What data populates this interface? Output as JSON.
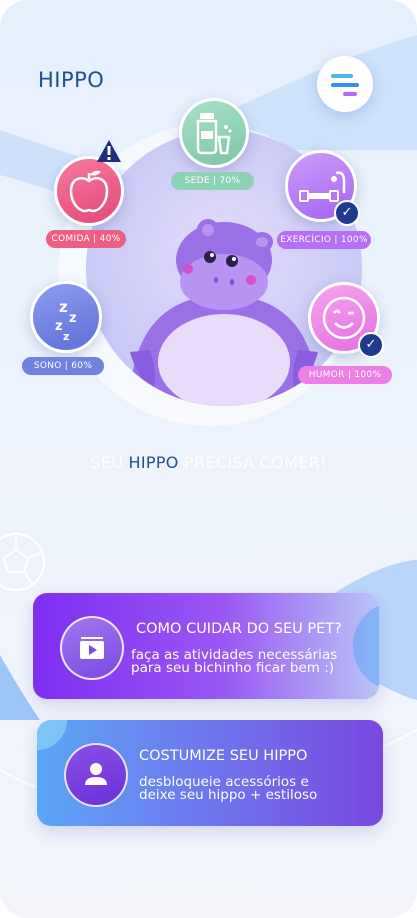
{
  "header": {
    "title": "HIPPO",
    "menu_icon": "menu-lines-icon"
  },
  "stats": [
    {
      "name": "sede",
      "label": "SEDE | 70%",
      "value_percent": 70,
      "icon": "water-bottle-icon",
      "color": "#8ed2b6"
    },
    {
      "name": "comida",
      "label": "COMIDA | 40%",
      "value_percent": 40,
      "icon": "apple-icon",
      "color": "#ee5f85",
      "alert": "warning-icon"
    },
    {
      "name": "exercicio",
      "label": "EXERCÍCIO | 100%",
      "value_percent": 100,
      "icon": "dumbbell-icon",
      "color": "#b56ef5",
      "done": "check-icon"
    },
    {
      "name": "sono",
      "label": "SONO | 60%",
      "value_percent": 60,
      "icon": "sleep-zzz-icon",
      "color": "#6f82e0"
    },
    {
      "name": "humor",
      "label": "HUMOR | 100%",
      "value_percent": 100,
      "icon": "smile-wink-icon",
      "color": "#ee7fe6",
      "done": "check-icon"
    }
  ],
  "message": {
    "prefix": "SEU ",
    "highlight": "HIPPO",
    "suffix": " PRECISA COMER!"
  },
  "cards": [
    {
      "title": "COMO CUIDAR DO SEU PET?",
      "line1": "faça as atividades necessárias",
      "line2": "para seu bichinho ficar bem :)",
      "icon": "video-library-icon"
    },
    {
      "title": "COSTUMIZE SEU HIPPO",
      "line1": "desbloqueie acessórios e",
      "line2": "deixe seu hippo + estiloso",
      "icon": "user-icon"
    }
  ],
  "colors": {
    "brand": "#1f4e96",
    "accent_purple": "#8a3cf0",
    "accent_blue": "#5aa6f5",
    "check": "#213a8f"
  }
}
